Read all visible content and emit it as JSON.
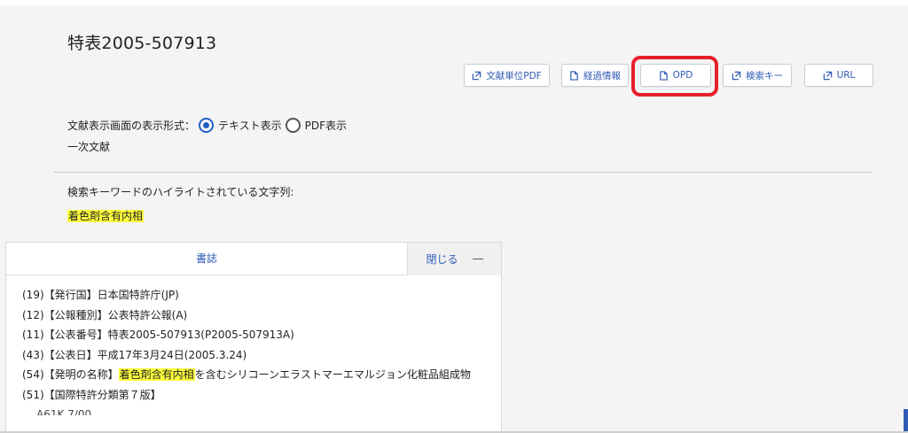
{
  "document": {
    "title": "特表2005-507913"
  },
  "toolbar": {
    "pdf_label": "文献単位PDF",
    "history_label": "経過情報",
    "opd_label": "OPD",
    "search_key_label": "検索キー",
    "url_label": "URL"
  },
  "display_format": {
    "label": "文献表示画面の表示形式：",
    "options": [
      "テキスト表示",
      "PDF表示"
    ],
    "selected": "テキスト表示"
  },
  "document_type": "一次文献",
  "keywords": {
    "label": "検索キーワードのハイライトされている文字列:",
    "value": "着色剤含有内相"
  },
  "panel": {
    "title": "書誌",
    "close_label": "閉じる"
  },
  "bibliography": {
    "country": "(19)【発行国】日本国特許庁(JP)",
    "kind": "(12)【公報種別】公表特許公報(A)",
    "number": "(11)【公表番号】特表2005-507913(P2005-507913A)",
    "date": "(43)【公表日】平成17年3月24日(2005.3.24)",
    "invention_prefix": "(54)【発明の名称】",
    "invention_highlight": "着色剤含有内相",
    "invention_suffix": "を含むシリコーンエラストマーエマルジョン化粧品組成物",
    "ipc_heading": "(51)【国際特許分類第７版】",
    "ipc_first": "A61K 7/00"
  },
  "colors": {
    "accent": "#2f5bb7",
    "highlight": "#ffff3c",
    "annotation": "#e5202a"
  }
}
